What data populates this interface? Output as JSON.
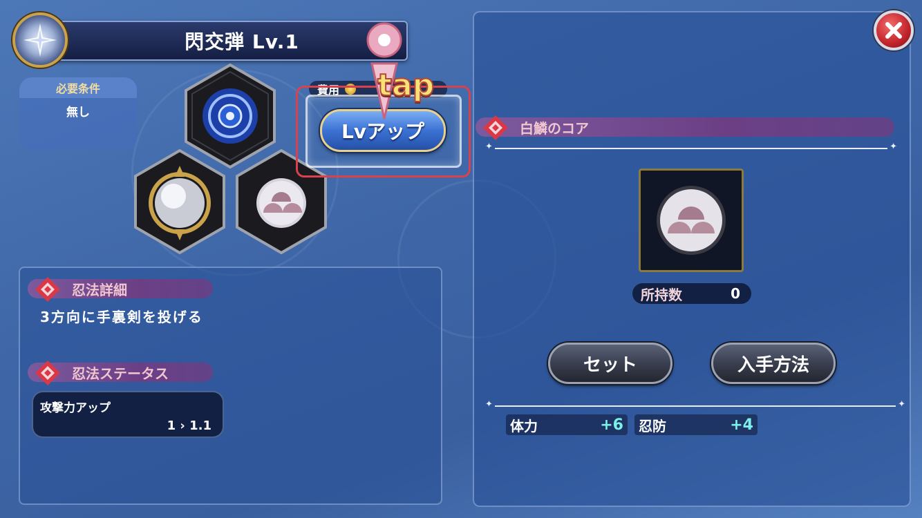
{
  "header": {
    "title": "閃交弾 Lv.1"
  },
  "requirement": {
    "label": "必要条件",
    "value": "無し"
  },
  "cost": {
    "label": "費用"
  },
  "lvup": {
    "label": "Lvアップ"
  },
  "tutorial": {
    "tap_text": "tap"
  },
  "ninpo_detail": {
    "heading": "忍法詳細",
    "description": "3方向に手裏剣を投げる"
  },
  "ninpo_status": {
    "heading": "忍法ステータス",
    "stat_name": "攻撃力アップ",
    "stat_value": "1 › 1.1"
  },
  "material": {
    "heading": "白鱗のコア",
    "owned_label": "所持数",
    "owned_count": "0"
  },
  "buttons": {
    "set": "セット",
    "obtain": "入手方法"
  },
  "bonuses": [
    {
      "label": "体力",
      "value": "+6"
    },
    {
      "label": "忍防",
      "value": "+4"
    }
  ],
  "icons": [
    "skill-emblem-icon",
    "blue-orb-icon",
    "silver-orb-icon",
    "white-scale-core-icon",
    "coin-icon",
    "close-icon",
    "diamond-emblem-icon"
  ],
  "colors": {
    "accent_red": "#d9424d",
    "lvup_blue": "#3c72d4",
    "bonus_cyan": "#7cf0e8",
    "section_purple": "#6c3f85"
  }
}
